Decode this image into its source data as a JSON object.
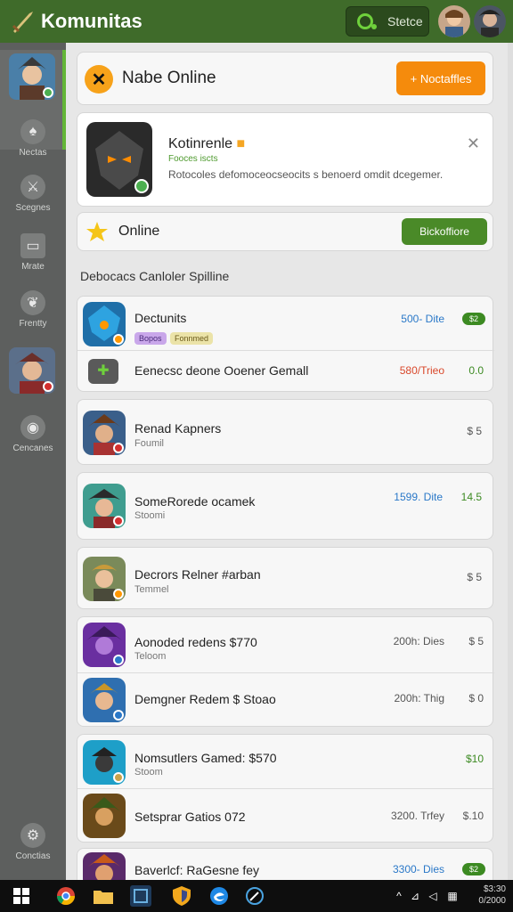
{
  "header": {
    "title": "Komunitas",
    "status_label": "Stetce"
  },
  "sidebar": {
    "items": [
      {
        "label": "Nectas"
      },
      {
        "label": "Scegnes"
      },
      {
        "label": "Mrate"
      },
      {
        "label": "Frentty"
      },
      {
        "label": "Cencanes"
      },
      {
        "label": "Conctias"
      }
    ]
  },
  "online_card": {
    "icon": "close-x-icon",
    "title": "Nabe Online",
    "button": "+ Noctaffles"
  },
  "notification": {
    "title": "Kotinrenle",
    "subtitle": "Fooces iscts",
    "description": "Rotocoles defomoceocseocits s benoerd omdit dcegemer."
  },
  "status": {
    "label": "Online",
    "button": "Bickoffiore"
  },
  "section_title": "Debocacs Canloler Spilline",
  "list": {
    "group1": [
      {
        "title": "Dectunits",
        "tag1": "Bopos",
        "tag2": "Fonnmed",
        "price": "500- Dite",
        "chip": "$2"
      },
      {
        "title": "Eenecsc deone Ooener Gemall",
        "price": "580/Trieo",
        "right": "0.0"
      }
    ],
    "rows": [
      {
        "title": "Renad Kapners",
        "sub": "Foumil",
        "right": "$ 5"
      },
      {
        "title": "SomeRorede ocamek",
        "sub": "Stoomi",
        "price": "1599. Dite",
        "right": "14.5"
      },
      {
        "title": "Decrors Relner #arban",
        "sub": "Temmel",
        "right": "$ 5"
      }
    ],
    "group2": [
      {
        "title": "Aonoded redens $770",
        "sub": "Teloom",
        "price": "200h: Dies",
        "right": "$ 5"
      },
      {
        "title": "Demgner Redem $ Stoao",
        "price": "200h: Thig",
        "right": "$ 0"
      }
    ],
    "group3": [
      {
        "title": "Nomsutlers Gamed: $570",
        "sub": "Stoom",
        "right": "$10"
      },
      {
        "title": "Setsprar Gatios 072",
        "price": "3200. Trfey",
        "right": "$.10"
      }
    ],
    "group4": [
      {
        "title": "Baverlcf: RaGesne fey",
        "price": "3300- Dies",
        "chip": "$2"
      }
    ]
  },
  "taskbar": {
    "time": "$3:30",
    "date": "0/2000"
  },
  "colors": {
    "header_bg": "#3f6b2a",
    "accent_green": "#4a8a28",
    "accent_orange": "#f58b0c",
    "price_blue": "#2a78c8",
    "price_red": "#d9482b"
  }
}
